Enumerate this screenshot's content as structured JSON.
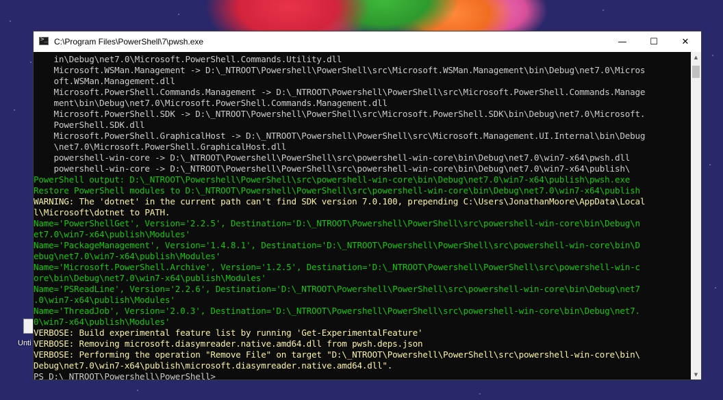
{
  "desktop": {
    "icon_label": "Unti"
  },
  "window": {
    "title": "C:\\Program Files\\PowerShell\\7\\pwsh.exe",
    "icon_glyph": ">_",
    "controls": {
      "minimize": "—",
      "maximize": "☐",
      "close": "✕"
    }
  },
  "console": {
    "lines": [
      {
        "color": "gray",
        "text": "    in\\Debug\\net7.0\\Microsoft.PowerShell.Commands.Utility.dll"
      },
      {
        "color": "gray",
        "text": "    Microsoft.WSMan.Management -> D:\\_NTROOT\\Powershell\\PowerShell\\src\\Microsoft.WSMan.Management\\bin\\Debug\\net7.0\\Micros"
      },
      {
        "color": "gray",
        "text": "    oft.WSMan.Management.dll"
      },
      {
        "color": "gray",
        "text": "    Microsoft.PowerShell.Commands.Management -> D:\\_NTROOT\\Powershell\\PowerShell\\src\\Microsoft.PowerShell.Commands.Manage"
      },
      {
        "color": "gray",
        "text": "    ment\\bin\\Debug\\net7.0\\Microsoft.PowerShell.Commands.Management.dll"
      },
      {
        "color": "gray",
        "text": "    Microsoft.PowerShell.SDK -> D:\\_NTROOT\\Powershell\\PowerShell\\src\\Microsoft.PowerShell.SDK\\bin\\Debug\\net7.0\\Microsoft."
      },
      {
        "color": "gray",
        "text": "    PowerShell.SDK.dll"
      },
      {
        "color": "gray",
        "text": "    Microsoft.PowerShell.GraphicalHost -> D:\\_NTROOT\\Powershell\\PowerShell\\src\\Microsoft.Management.UI.Internal\\bin\\Debug"
      },
      {
        "color": "gray",
        "text": "    \\net7.0\\Microsoft.PowerShell.GraphicalHost.dll"
      },
      {
        "color": "gray",
        "text": "    powershell-win-core -> D:\\_NTROOT\\Powershell\\PowerShell\\src\\powershell-win-core\\bin\\Debug\\net7.0\\win7-x64\\pwsh.dll"
      },
      {
        "color": "gray",
        "text": "    powershell-win-core -> D:\\_NTROOT\\Powershell\\PowerShell\\src\\powershell-win-core\\bin\\Debug\\net7.0\\win7-x64\\publish\\"
      },
      {
        "color": "green",
        "text": "PowerShell output: D:\\_NTROOT\\Powershell\\PowerShell\\src\\powershell-win-core\\bin\\Debug\\net7.0\\win7-x64\\publish\\pwsh.exe"
      },
      {
        "color": "green",
        "text": "Restore PowerShell modules to D:\\_NTROOT\\Powershell\\PowerShell\\src\\powershell-win-core\\bin\\Debug\\net7.0\\win7-x64\\publish"
      },
      {
        "color": "yellow",
        "text": "WARNING: The 'dotnet' in the current path can't find SDK version 7.0.100, prepending C:\\Users\\JonathanMoore\\AppData\\Local"
      },
      {
        "color": "yellow",
        "text": "l\\Microsoft\\dotnet to PATH."
      },
      {
        "color": "green",
        "text": "Name='PowerShellGet', Version='2.2.5', Destination='D:\\_NTROOT\\Powershell\\PowerShell\\src\\powershell-win-core\\bin\\Debug\\n"
      },
      {
        "color": "green",
        "text": "et7.0\\win7-x64\\publish\\Modules'"
      },
      {
        "color": "green",
        "text": "Name='PackageManagement', Version='1.4.8.1', Destination='D:\\_NTROOT\\Powershell\\PowerShell\\src\\powershell-win-core\\bin\\D"
      },
      {
        "color": "green",
        "text": "ebug\\net7.0\\win7-x64\\publish\\Modules'"
      },
      {
        "color": "green",
        "text": "Name='Microsoft.PowerShell.Archive', Version='1.2.5', Destination='D:\\_NTROOT\\Powershell\\PowerShell\\src\\powershell-win-c"
      },
      {
        "color": "green",
        "text": "ore\\bin\\Debug\\net7.0\\win7-x64\\publish\\Modules'"
      },
      {
        "color": "green",
        "text": "Name='PSReadLine', Version='2.2.6', Destination='D:\\_NTROOT\\Powershell\\PowerShell\\src\\powershell-win-core\\bin\\Debug\\net7"
      },
      {
        "color": "green",
        "text": ".0\\win7-x64\\publish\\Modules'"
      },
      {
        "color": "green",
        "text": "Name='ThreadJob', Version='2.0.3', Destination='D:\\_NTROOT\\Powershell\\PowerShell\\src\\powershell-win-core\\bin\\Debug\\net7."
      },
      {
        "color": "green",
        "text": "0\\win7-x64\\publish\\Modules'"
      },
      {
        "color": "yellow",
        "text": "VERBOSE: Build experimental feature list by running 'Get-ExperimentalFeature'"
      },
      {
        "color": "yellow",
        "text": "VERBOSE: Removing microsoft.diasymreader.native.amd64.dll from pwsh.deps.json"
      },
      {
        "color": "yellow",
        "text": "VERBOSE: Performing the operation \"Remove File\" on target \"D:\\_NTROOT\\Powershell\\PowerShell\\src\\powershell-win-core\\bin\\"
      },
      {
        "color": "yellow",
        "text": "Debug\\net7.0\\win7-x64\\publish\\microsoft.diasymreader.native.amd64.dll\"."
      },
      {
        "color": "gray",
        "text": "PS D:\\_NTROOT\\Powershell\\PowerShell>"
      }
    ]
  },
  "colors": {
    "desktop_bg": "#28286a",
    "console_bg": "#0c0c0c",
    "text_gray": "#cccccc",
    "text_green": "#16c60c",
    "text_yellow": "#f9f1a5",
    "titlebar_bg": "#ffffff"
  },
  "icons": {
    "app": "powershell-icon",
    "scroll_up": "triangle-up",
    "scroll_down": "triangle-down"
  }
}
